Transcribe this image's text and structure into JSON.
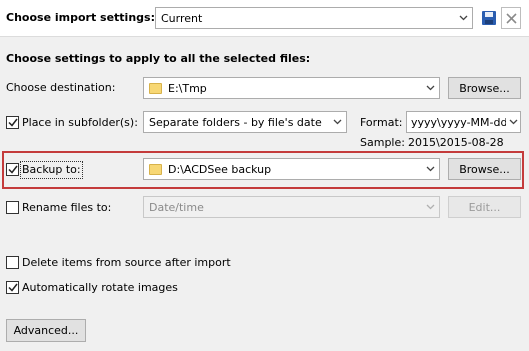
{
  "import_settings": {
    "label": "Choose import settings:",
    "preset_value": "Current",
    "save_icon": "floppy-disk-icon",
    "delete_icon": "close-icon"
  },
  "section_heading": "Choose settings to apply to all the selected files:",
  "destination": {
    "label": "Choose destination:",
    "value": "E:\\Tmp",
    "browse_label": "Browse..."
  },
  "subfolder": {
    "label": "Place in subfolder(s):",
    "checked": true,
    "value": "Separate folders - by file's date",
    "format_label": "Format:",
    "format_value": "yyyy\\yyyy-MM-dd",
    "sample_label": "Sample:",
    "sample_value": "2015\\2015-08-28"
  },
  "backup": {
    "label": "Backup to:",
    "checked": true,
    "value": "D:\\ACDSee backup",
    "browse_label": "Browse..."
  },
  "rename": {
    "label": "Rename files to:",
    "checked": false,
    "value": "Date/time",
    "edit_label": "Edit..."
  },
  "options": {
    "delete_label": "Delete items from source after import",
    "delete_checked": false,
    "rotate_label": "Automatically rotate images",
    "rotate_checked": true
  },
  "advanced_label": "Advanced...",
  "colors": {
    "highlight": "#c43b3b",
    "background": "#f0f0f0"
  }
}
